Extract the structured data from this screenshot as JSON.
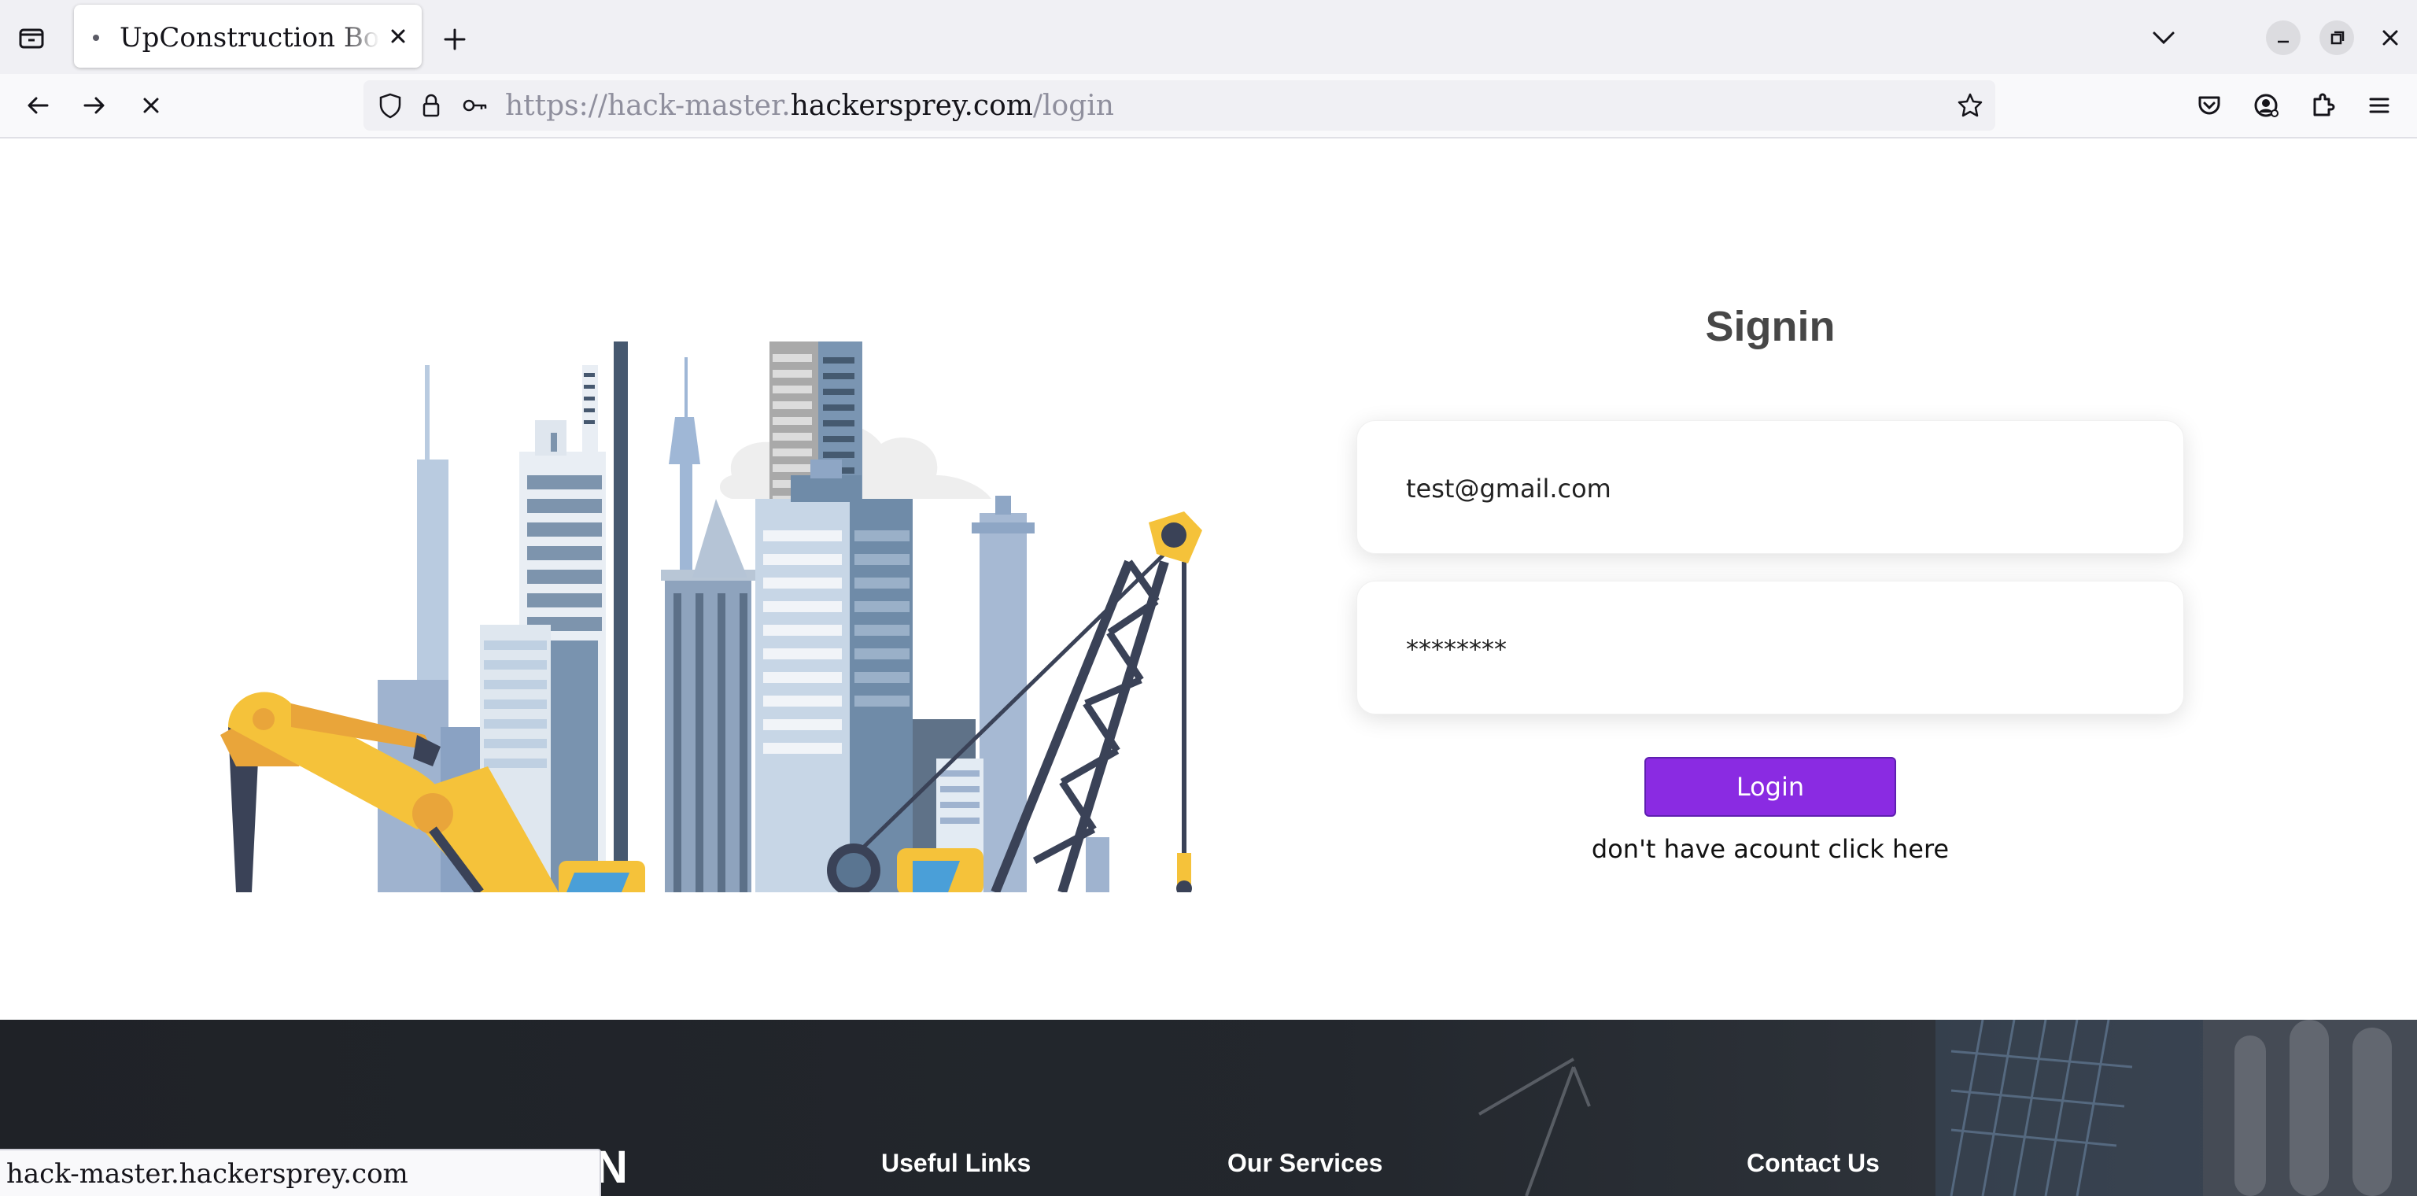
{
  "browser": {
    "tab": {
      "title": "UpConstruction Booking"
    },
    "url": {
      "scheme": "https://",
      "subdomain": "hack-master.",
      "domain": "hackersprey.com",
      "path": "/login"
    },
    "status_url": "hack-master.hackersprey.com",
    "icons": [
      "tab-list-icon",
      "close-icon",
      "plus-icon",
      "chevron-down-icon",
      "minimize-icon",
      "restore-icon",
      "window-close-icon",
      "back-arrow-icon",
      "forward-arrow-icon",
      "stop-loading-icon",
      "shield-icon",
      "lock-icon",
      "key-icon",
      "star-icon",
      "pocket-icon",
      "account-icon",
      "extensions-icon",
      "menu-icon"
    ]
  },
  "login": {
    "title": "Signin",
    "email_value": "test@gmail.com",
    "password_value": "********",
    "login_button": "Login",
    "signup_link": "don't have acount click here",
    "accent_color": "#8a2be2"
  },
  "footer": {
    "logo_fragment": "N",
    "headings": [
      "Useful Links",
      "Our Services",
      "Contact Us"
    ]
  }
}
